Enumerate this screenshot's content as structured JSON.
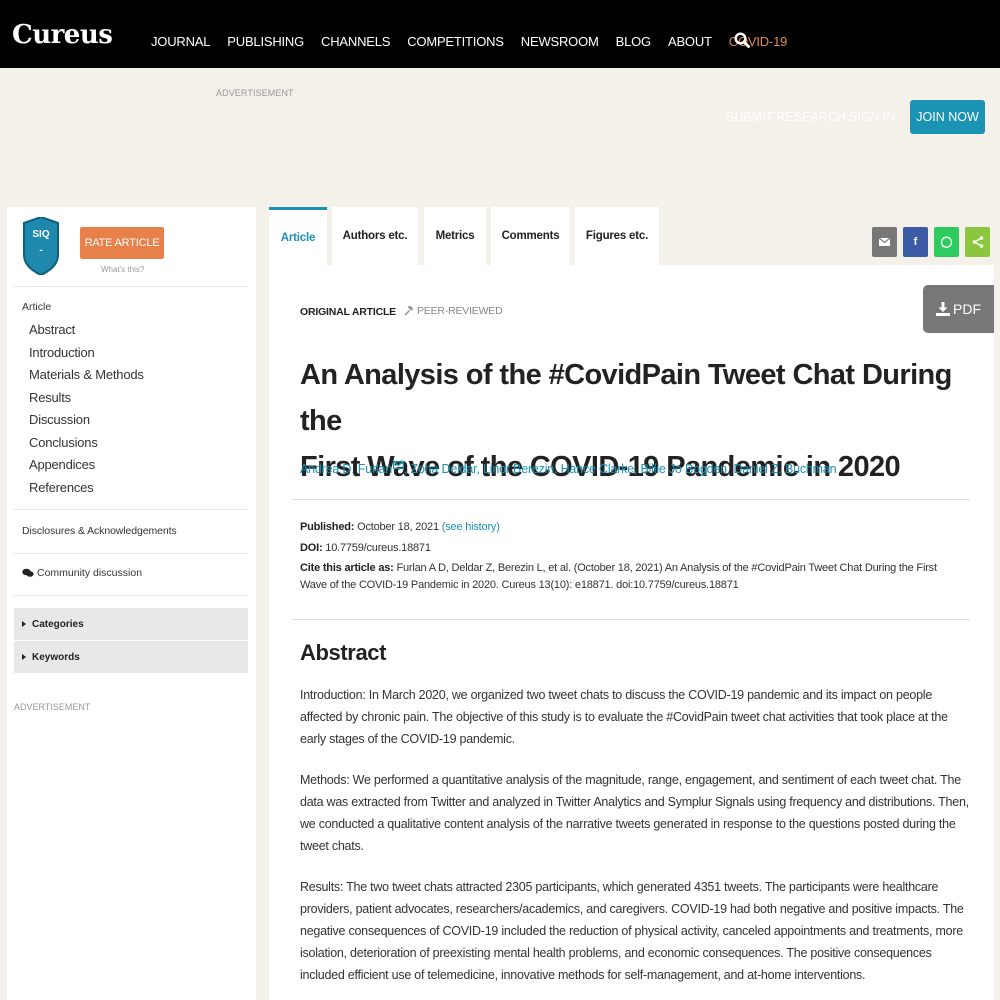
{
  "nav": {
    "logo": "Cureus",
    "items": [
      "JOURNAL",
      "PUBLISHING",
      "CHANNELS",
      "COMPETITIONS",
      "NEWSROOM",
      "BLOG",
      "ABOUT",
      "COVID-19"
    ],
    "search_icon": "search-icon"
  },
  "header": {
    "ad_label": "ADVERTISEMENT",
    "submit_research": "SUBMIT RESEARCH",
    "sign_in": "SIGN IN",
    "join_now": "JOIN NOW"
  },
  "sidebar": {
    "siq_label": "SIQ",
    "siq_score": "-",
    "rate_article": "RATE ARTICLE",
    "whats_this": "What's this?",
    "article_heading": "Article",
    "sections": [
      "Abstract",
      "Introduction",
      "Materials & Methods",
      "Results",
      "Discussion",
      "Conclusions",
      "Appendices",
      "References"
    ],
    "disclosures": "Disclosures & Acknowledgements",
    "community": "Community discussion",
    "accordions": [
      "Categories",
      "Keywords"
    ],
    "ad_label": "ADVERTISEMENT"
  },
  "tabs": [
    {
      "label": "Article",
      "active": true
    },
    {
      "label": "Authors etc.",
      "active": false
    },
    {
      "label": "Metrics",
      "active": false
    },
    {
      "label": "Comments",
      "active": false
    },
    {
      "label": "Figures etc.",
      "active": false
    }
  ],
  "share": {
    "buttons": [
      {
        "name": "email",
        "color": "#777777"
      },
      {
        "name": "facebook",
        "color": "#3b5ba6"
      },
      {
        "name": "whatsapp",
        "color": "#2ecc5f"
      },
      {
        "name": "share",
        "color": "#8cc63f"
      }
    ]
  },
  "article": {
    "pdf_label": "PDF",
    "type": "ORIGINAL ARTICLE",
    "peer_reviewed": "PEER-REVIEWED",
    "title_line1": "An Analysis of the #CovidPain Tweet Chat During the",
    "title_line2": "First Wave of the COVID-19 Pandemic in 2020",
    "authors": [
      "Andrea D. Furlan",
      "Zoha Deldar",
      "Linor Berezin",
      "Hance Clarke",
      "Billie Jo Bogden",
      "Daniel Z. Buchman"
    ],
    "published_label": "Published:",
    "published_date": "October 18, 2021",
    "see_history": "(see history)",
    "doi_label": "DOI:",
    "doi": "10.7759/cureus.18871",
    "cite_label": "Cite this article as:",
    "cite_line1": "Furlan A D, Deldar Z, Berezin L, et al. (October 18, 2021) An Analysis of the #CovidPain Tweet Chat During the First",
    "cite_line2": "Wave of the COVID-19 Pandemic in 2020. Cureus 13(10): e18871. doi:10.7759/cureus.18871",
    "abstract_heading": "Abstract",
    "abstract_intro": "Introduction: In March 2020, we organized two tweet chats to discuss the COVID-19 pandemic and its impact on people affected by chronic pain. The objective of this study is to evaluate the #CovidPain tweet chat activities that took place at the early stages of the COVID-19 pandemic.",
    "abstract_methods": "Methods: We performed a quantitative analysis of the magnitude, range, engagement, and sentiment of each tweet chat. The data was extracted from Twitter and analyzed in Twitter Analytics and Symplur Signals using frequency and distributions. Then, we conducted a qualitative content analysis of the narrative tweets generated in response to the questions posted during the tweet chats.",
    "abstract_results": "Results: The two tweet chats attracted 2305 participants, which generated 4351 tweets. The participants were healthcare providers, patient advocates, researchers/academics, and caregivers. COVID-19 had both negative and positive impacts. The negative consequences of COVID-19 included the reduction of physical activity, canceled appointments and treatments, more isolation, deterioration of preexisting mental health problems, and economic consequences. The positive consequences included efficient use of telemedicine, innovative methods for self-management, and at-home interventions."
  }
}
